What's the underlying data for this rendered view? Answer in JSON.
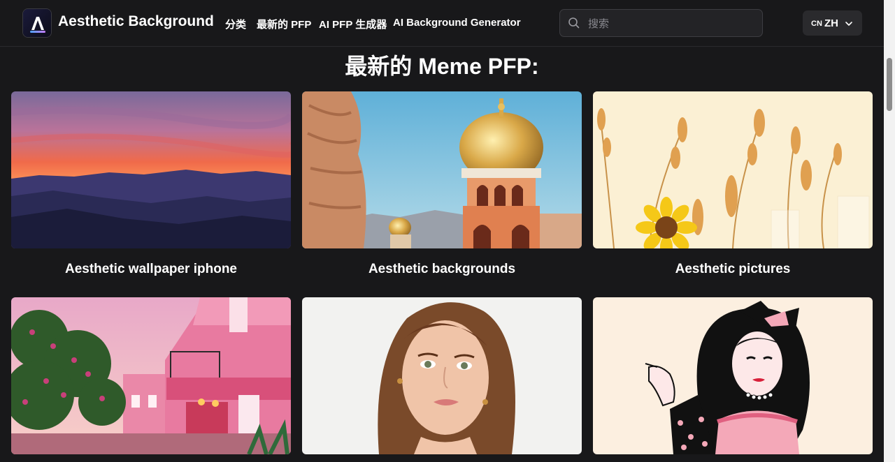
{
  "header": {
    "brand": "Aesthetic Background",
    "nav": [
      {
        "label": "分类"
      },
      {
        "label": "最新的 PFP"
      },
      {
        "label": "AI PFP 生成器"
      },
      {
        "label": "AI Background Generator"
      }
    ],
    "search": {
      "placeholder": "搜索",
      "value": ""
    },
    "language": {
      "flag": "CN",
      "code": "ZH"
    }
  },
  "main": {
    "title": "最新的 Meme PFP:",
    "cards": [
      {
        "caption": "Aesthetic wallpaper iphone",
        "image": "sunset-mountains"
      },
      {
        "caption": "Aesthetic backgrounds",
        "image": "golden-dome-tower"
      },
      {
        "caption": "Aesthetic pictures",
        "image": "wheat-sunflower"
      },
      {
        "caption": "",
        "image": "pink-buildings"
      },
      {
        "caption": "",
        "image": "woman-portrait"
      },
      {
        "caption": "",
        "image": "pinup-illustration"
      }
    ]
  },
  "colors": {
    "background": "#18181a",
    "surface": "#232326",
    "text": "#ffffff"
  }
}
